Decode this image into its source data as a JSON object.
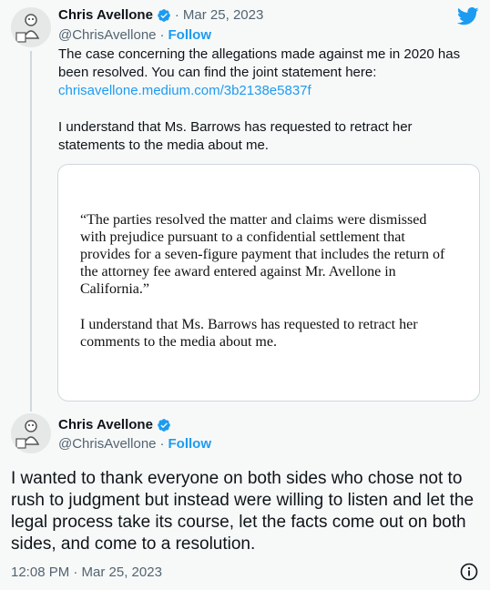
{
  "tweet1": {
    "name": "Chris Avellone",
    "date": "Mar 25, 2023",
    "handle": "@ChrisAvellone",
    "follow": "Follow",
    "para1": "The case concerning the allegations made against me in 2020 has been resolved. You can find the joint statement here:",
    "link": "chrisavellone.medium.com/3b2138e5837f",
    "para2": "I understand that Ms. Barrows has requested to retract her statements to the media about me.",
    "card_quote": "“The parties resolved the matter and claims were dismissed with prejudice pursuant to a confidential settlement that provides for a seven-figure payment that includes the return of the attorney fee award entered against Mr. Avellone in California.”",
    "card_para2": "I understand that Ms. Barrows has requested to retract her comments to the media about me."
  },
  "tweet2": {
    "name": "Chris Avellone",
    "handle": "@ChrisAvellone",
    "follow": "Follow",
    "text": "I wanted to thank everyone on both sides who chose not to rush to judgment but instead were willing to listen and let the legal process take its course, let the facts come out on both sides, and come to a resolution.",
    "timestamp": "12:08 PM · Mar 25, 2023"
  },
  "separator": "·",
  "icons": {
    "twitter": "twitter-bird-icon",
    "verified": "verified-badge-icon",
    "info": "info-icon"
  },
  "colors": {
    "accent": "#1d9bf0",
    "muted": "#536471"
  }
}
